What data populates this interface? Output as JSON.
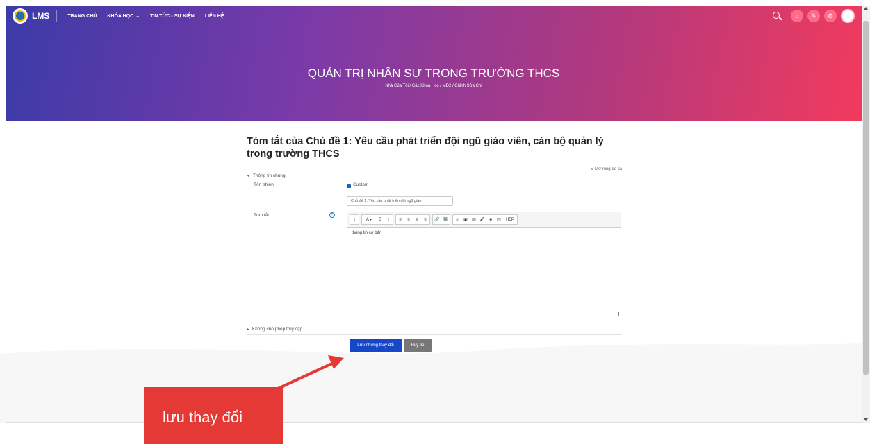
{
  "navbar": {
    "logo_text": "LMS",
    "links": [
      {
        "label": "TRANG CHỦ"
      },
      {
        "label": "KHÓA HỌC",
        "has_dropdown": true
      },
      {
        "label": "TIN TỨC - SỰ KIỆN"
      },
      {
        "label": "LIÊN HỆ"
      }
    ]
  },
  "hero": {
    "title": "QUẢN TRỊ NHÂN SỰ TRONG TRƯỜNG THCS",
    "breadcrumb": "Nhà Của Tôi  /  Các Khoá Học  /  MĐ2  /  Chỉnh Sửa Chi"
  },
  "form": {
    "title": "Tóm tắt của Chủ đề 1: Yêu cầu phát triển đội ngũ giáo viên, cán bộ quản lý trong trường THCS",
    "expand_all": "▸ Mở rộng tất cả",
    "section_general": "Thông tin chung",
    "label_name": "Tên phiên",
    "custom_checkbox_label": "Custom",
    "custom_checked": true,
    "name_value": "Chủ đề 1: Yêu cầu phát triển đội ngũ giáo",
    "label_summary": "Tóm tắt",
    "editor_text": "thông tin cơ bản",
    "section_restrict": "Không cho phép truy cập",
    "save_label": "Lưu những thay đổi",
    "cancel_label": "Huỷ bỏ"
  },
  "toolbar": [
    "i",
    "A ▾",
    "B",
    "I",
    "≡",
    "≡",
    "≡",
    "≡",
    "🔗",
    "⛓",
    "☺",
    "▣",
    "▤",
    "🎤",
    "■",
    "◫",
    "H5P"
  ],
  "annotation": {
    "callout_text": "lưu thay đổi"
  },
  "colors": {
    "hero_gradient_start": "#3b3ba8",
    "hero_gradient_end": "#f23a5d",
    "save_button": "#1646c9",
    "cancel_button": "#777777",
    "callout": "#e53935"
  }
}
